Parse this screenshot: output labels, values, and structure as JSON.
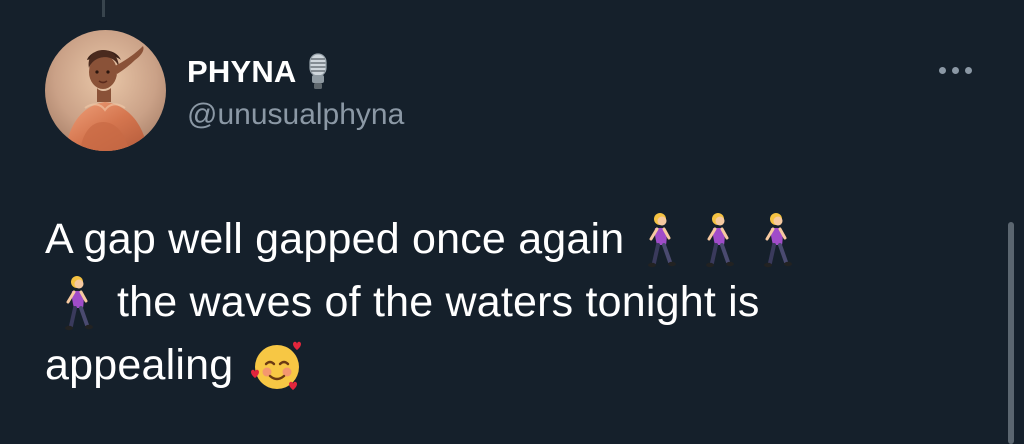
{
  "author": {
    "display_name": "PHYNA",
    "name_badge_icon": "microphone-icon",
    "username": "@unusualphyna",
    "avatar_icon": "profile-photo"
  },
  "menu": {
    "more_icon": "more-horizontal-icon"
  },
  "tweet": {
    "line1_text": "A gap well gapped once again",
    "line2_text": "the waves of the waters tonight is",
    "line3_text": "appealing",
    "emojis": [
      "woman-walking",
      "woman-walking",
      "woman-walking",
      "woman-walking",
      "smiling-face-with-hearts"
    ]
  },
  "colors": {
    "background": "#15202b",
    "primary_text": "#ffffff",
    "secondary_text": "#8b98a5"
  }
}
